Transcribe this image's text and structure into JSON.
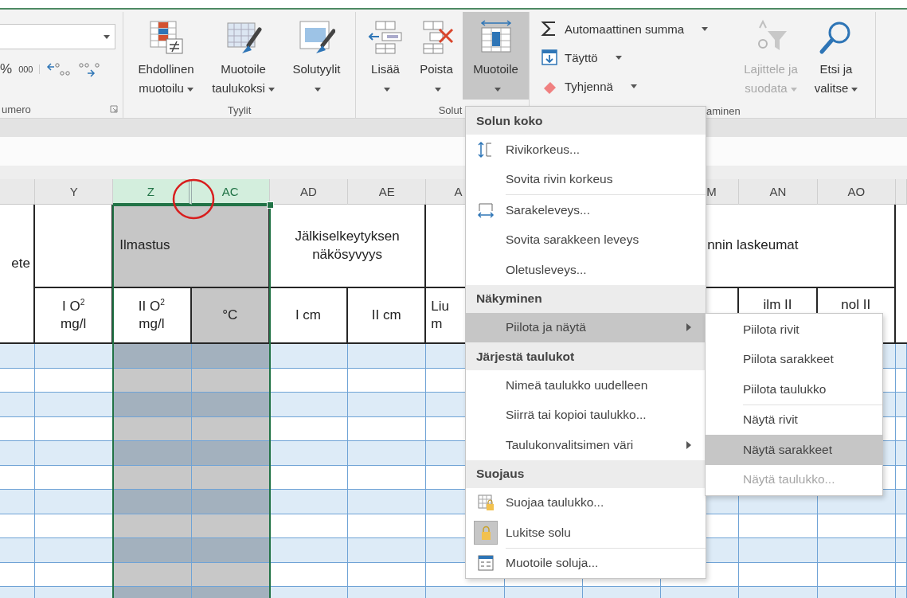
{
  "ribbon": {
    "number_group": {
      "label": "umero",
      "buttons": [
        "%",
        "000"
      ]
    },
    "styles_group": {
      "label": "Tyylit",
      "buttons": [
        {
          "lines": [
            "Ehdollinen",
            "muotoilu"
          ],
          "dropdown": true,
          "selected": false,
          "disabled": false
        },
        {
          "lines": [
            "Muotoile",
            "taulukoksi"
          ],
          "dropdown": true,
          "selected": false,
          "disabled": false
        },
        {
          "lines": [
            "Solutyylit"
          ],
          "dropdown": true,
          "selected": false,
          "disabled": false
        }
      ]
    },
    "cells_group": {
      "label": "Solut",
      "buttons": [
        {
          "lines": [
            "Lisää"
          ],
          "dropdown": true,
          "selected": false,
          "disabled": false
        },
        {
          "lines": [
            "Poista"
          ],
          "dropdown": true,
          "selected": false,
          "disabled": false
        },
        {
          "lines": [
            "Muotoile"
          ],
          "dropdown": true,
          "selected": true,
          "disabled": false
        }
      ]
    },
    "editing_group": {
      "label": "aminen",
      "small_buttons": [
        {
          "label": "Automaattinen summa",
          "dropdown": true
        },
        {
          "label": "Täyttö",
          "dropdown": true
        },
        {
          "label": "Tyhjennä",
          "dropdown": true
        }
      ],
      "buttons": [
        {
          "lines": [
            "Lajittele ja",
            "suodata"
          ],
          "dropdown": true,
          "selected": false,
          "disabled": true
        },
        {
          "lines": [
            "Etsi ja",
            "valitse"
          ],
          "dropdown": true,
          "selected": false,
          "disabled": false
        }
      ]
    }
  },
  "sheet": {
    "columns": [
      {
        "label": "Y",
        "selected": false,
        "shaded": false
      },
      {
        "label": "Z",
        "selected": true,
        "shaded": true
      },
      {
        "label": "AC",
        "selected": true,
        "shaded": true
      },
      {
        "label": "AD",
        "selected": false,
        "shaded": false
      },
      {
        "label": "AE",
        "selected": false,
        "shaded": false
      },
      {
        "label": "A",
        "selected": false,
        "shaded": false
      },
      {
        "label": "M",
        "selected": false,
        "shaded": false
      },
      {
        "label": "AN",
        "selected": false,
        "shaded": false
      },
      {
        "label": "AO",
        "selected": false,
        "shaded": false
      }
    ],
    "title_row": [
      {
        "lines": [
          "ete"
        ],
        "shaded": false
      },
      {
        "lines": [
          "Ilmastus"
        ],
        "shaded": true
      },
      {
        "lines": [
          "Jälkiselkeytyksen",
          "näkösyvyys"
        ],
        "shaded": false
      },
      {
        "lines": [
          "nnin laskeumat"
        ],
        "shaded": false
      }
    ],
    "unit_row": [
      {
        "lines": [
          "I O$^{2}$",
          "mg/l"
        ],
        "shaded": false
      },
      {
        "lines": [
          "II O$^{2}$",
          "mg/l"
        ],
        "shaded": false
      },
      {
        "lines": [
          "°C"
        ],
        "shaded": true
      },
      {
        "lines": [
          "I cm"
        ],
        "shaded": false
      },
      {
        "lines": [
          "II cm"
        ],
        "shaded": false
      },
      {
        "lines": [
          "Liu",
          "m"
        ],
        "shaded": false
      },
      {
        "lines": [
          "ilm II"
        ],
        "shaded": false
      },
      {
        "lines": [
          "nol II"
        ],
        "shaded": false
      }
    ]
  },
  "format_menu": {
    "items": [
      {
        "kind": "header",
        "label": "Solun koko"
      },
      {
        "kind": "item",
        "label": "Rivikorkeus...",
        "selected": false,
        "disabled": false,
        "checked": false
      },
      {
        "kind": "item",
        "label": "Sovita rivin korkeus",
        "selected": false,
        "disabled": false,
        "checked": false
      },
      {
        "kind": "separator"
      },
      {
        "kind": "item",
        "label": "Sarakeleveys...",
        "selected": false,
        "disabled": false,
        "checked": false
      },
      {
        "kind": "item",
        "label": "Sovita sarakkeen leveys",
        "selected": false,
        "disabled": false,
        "checked": false
      },
      {
        "kind": "item",
        "label": "Oletusleveys...",
        "selected": false,
        "disabled": false,
        "checked": false
      },
      {
        "kind": "header",
        "label": "Näkyminen"
      },
      {
        "kind": "submenu",
        "label": "Piilota ja näytä",
        "selected": true,
        "disabled": false,
        "checked": false
      },
      {
        "kind": "header",
        "label": "Järjestä taulukot"
      },
      {
        "kind": "item",
        "label": "Nimeä taulukko uudelleen",
        "selected": false,
        "disabled": false,
        "checked": false
      },
      {
        "kind": "item",
        "label": "Siirrä tai kopioi taulukko...",
        "selected": false,
        "disabled": false,
        "checked": false
      },
      {
        "kind": "submenu",
        "label": "Taulukonvalitsimen väri",
        "selected": false,
        "disabled": false,
        "checked": false
      },
      {
        "kind": "header",
        "label": "Suojaus"
      },
      {
        "kind": "item",
        "label": "Suojaa taulukko...",
        "selected": false,
        "disabled": false,
        "checked": false
      },
      {
        "kind": "item",
        "label": "Lukitse solu",
        "selected": false,
        "disabled": false,
        "checked": true
      },
      {
        "kind": "separator"
      },
      {
        "kind": "item",
        "label": "Muotoile soluja...",
        "selected": false,
        "disabled": false,
        "checked": false
      }
    ]
  },
  "submenu": {
    "items": [
      {
        "kind": "item",
        "label": "Piilota rivit",
        "selected": false,
        "disabled": false
      },
      {
        "kind": "item",
        "label": "Piilota sarakkeet",
        "selected": false,
        "disabled": false
      },
      {
        "kind": "item",
        "label": "Piilota taulukko",
        "selected": false,
        "disabled": false
      },
      {
        "kind": "separator"
      },
      {
        "kind": "item",
        "label": "Näytä rivit",
        "selected": false,
        "disabled": false
      },
      {
        "kind": "item",
        "label": "Näytä sarakkeet",
        "selected": true,
        "disabled": false
      },
      {
        "kind": "item",
        "label": "Näytä taulukko...",
        "selected": false,
        "disabled": true
      }
    ]
  }
}
